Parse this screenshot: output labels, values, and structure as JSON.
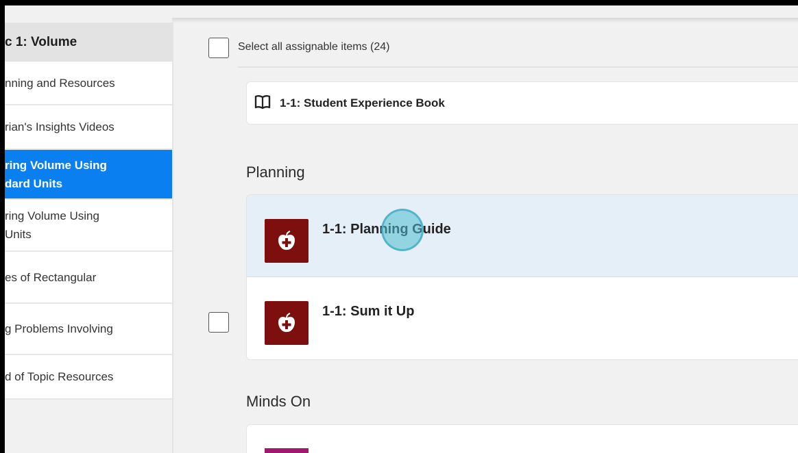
{
  "sidebar": {
    "title": "c 1: Volume",
    "items": [
      {
        "label": "nning and Resources",
        "active": false
      },
      {
        "label": "rian's Insights Videos",
        "active": false
      },
      {
        "label": "ring Volume Using\ndard Units",
        "active": true
      },
      {
        "label": "ring Volume Using\nUnits",
        "active": false
      },
      {
        "label": "es of Rectangular\n",
        "active": false
      },
      {
        "label": "g Problems Involving\n",
        "active": false
      },
      {
        "label": "d of Topic Resources",
        "active": false
      }
    ]
  },
  "main": {
    "select_all_label": "Select all assignable items (24)",
    "book_item": {
      "title": "1-1: Student Experience Book",
      "icon": "book-icon"
    },
    "sections": [
      {
        "heading": "Planning",
        "items": [
          {
            "title": "1-1: Planning Guide",
            "icon": "apple-plus-icon",
            "highlighted": true
          },
          {
            "title": "1-1: Sum it Up",
            "icon": "apple-plus-icon",
            "highlighted": false
          }
        ]
      },
      {
        "heading": "Minds On",
        "items": []
      }
    ]
  },
  "colors": {
    "active": "#0a7ff0",
    "resource_icon": "#7d0f0f",
    "minds_on_icon": "#a0196e",
    "highlight_row": "#e5eff8"
  }
}
